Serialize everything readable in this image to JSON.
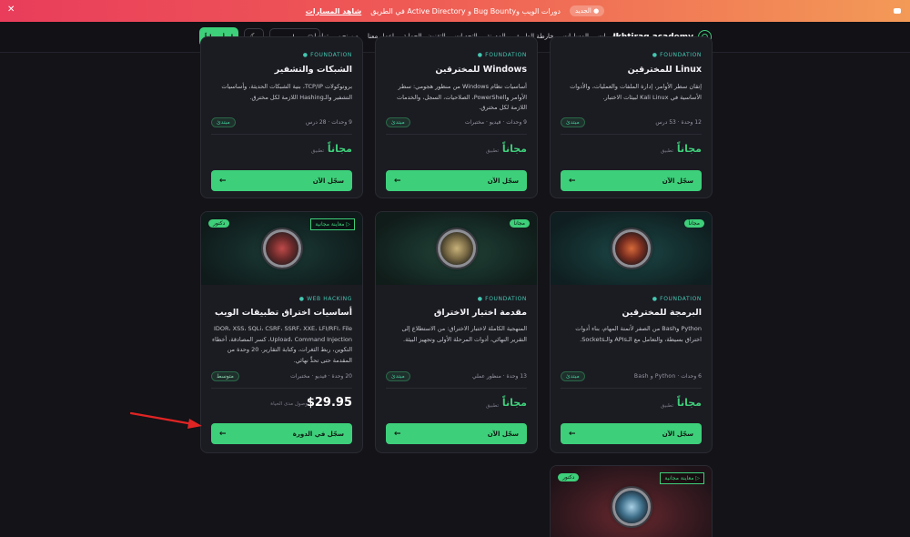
{
  "announcement": {
    "badge": "● الجديد",
    "text": "دورات الويب وBug Bounty و Active Directory في الطريق",
    "link": "شاهد المسارات"
  },
  "nav": {
    "brand": "Ikhtiraq academy",
    "links": [
      "الدورات",
      "المسارات",
      "خارطة الطريق",
      "المدونة",
      "التحديات",
      "التقنون والجماية",
      "اعمل معنا",
      "من نحن",
      "تواصل"
    ],
    "account_label": "حسابي",
    "start_label": "ابدأ مجاناً"
  },
  "cards_top": [
    {
      "tag": "FOUNDATION ●",
      "title": "Linux للمخترقين",
      "desc": "إتقان سطر الأوامر، إدارة الملفات والعمليات، والأدوات الأساسية في Kali Linux لبيئات الاختبار.",
      "meta": "12 وحدة · 53 درس",
      "level": "مبتدئ",
      "price": "مجاناً",
      "price_sub": "تطبيق",
      "cta": "سجّل الآن"
    },
    {
      "tag": "FOUNDATION ●",
      "title": "Windows للمخترقين",
      "desc": "أساسيات نظام Windows من منظور هجومي: سطر الأوامر وPowerShell، الصلاحيات، السجل، والخدمات اللازمة لكل مخترق.",
      "meta": "9 وحدات · فيديو · مختبرات",
      "level": "مبتدئ",
      "price": "مجاناً",
      "price_sub": "تطبيق",
      "cta": "سجّل الآن"
    },
    {
      "tag": "FOUNDATION ●",
      "title": "الشبكات والتشفير",
      "desc": "بروتوكولات TCP/IP، بنية الشبكات الحديثة، وأساسيات التشفير والـHashing اللازمة لكل مخترق.",
      "meta": "9 وحدات · 28 درس",
      "level": "مبتدئ",
      "price": "مجاناً",
      "price_sub": "تطبيق",
      "cta": "سجّل الآن"
    }
  ],
  "cards_mid": [
    {
      "badge": "مجاناً",
      "tag": "FOUNDATION ●",
      "title": "البرمجة للمخترقين",
      "desc": "Python وBash من الصفر لأتمتة المهام، بناء أدوات اختراق بسيطة، والتعامل مع الـAPIs والـSockets.",
      "meta": "6 وحدات · Python و Bash",
      "level": "مبتدئ",
      "price": "مجاناً",
      "price_sub": "تطبيق",
      "cta": "سجّل الآن"
    },
    {
      "badge": "مجاناً",
      "tag": "FOUNDATION ●",
      "title": "مقدمة اختبار الاختراق",
      "desc": "المنهجية الكاملة لاختبار الاختراق: من الاستطلاع إلى التقرير النهائي، أدوات المرحلة الأولى وتجهيز البيئة.",
      "meta": "13 وحدة · منظور عملي",
      "level": "مبتدئ",
      "price": "مجاناً",
      "price_sub": "تطبيق",
      "cta": "سجّل الآن"
    },
    {
      "badge": "دكتور",
      "preview": "▷ معاينة مجانية",
      "tag": "WEB HACKING ●",
      "title": "أساسيات اختراق تطبيقات الويب",
      "desc": "IDOR، XSS، SQLi، CSRF، SSRF، XXE، LFI/RFI، File Upload، Command Injection، كسر المصادقة، أخطاء التكوين، ربط الثغرات، وكتابة التقارير. 20 وحدة من المقدمة حتى تحدٍّ نهائي.",
      "meta": "20 وحدة · فيديو · مختبرات",
      "level": "متوسط",
      "price": "$29.95",
      "price_sub": "وصول مدى الحياة",
      "cta": "سجّل في الدورة"
    }
  ],
  "card_bottom": {
    "badge": "دكتور",
    "preview": "▷ معاينة مجانية"
  }
}
